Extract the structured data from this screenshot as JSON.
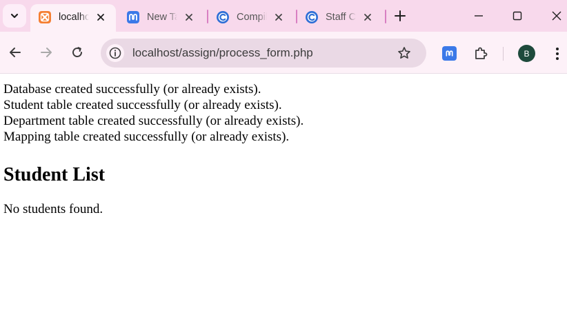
{
  "tabs": [
    {
      "title": "localhost/assign/process_form.php",
      "icon": "xampp-icon",
      "active": true
    },
    {
      "title": "New Tab",
      "icon": "app-icon",
      "active": false
    },
    {
      "title": "Compiler",
      "icon": "c-icon",
      "active": false
    },
    {
      "title": "Staff Compiler",
      "icon": "c-icon",
      "active": false
    }
  ],
  "toolbar": {
    "url": "localhost/assign/process_form.php",
    "profile_initial": "B"
  },
  "page": {
    "messages": [
      "Database created successfully (or already exists).",
      "Student table created successfully (or already exists).",
      "Department table created successfully (or already exists).",
      "Mapping table created successfully (or already exists)."
    ],
    "heading": "Student List",
    "empty_text": "No students found."
  },
  "colors": {
    "tabstrip": "#f8d9ec",
    "toolbar": "#fdf1f8",
    "omnibox": "#ead9e5",
    "xampp": "#f57f33",
    "app_blue": "#3b79e8",
    "avatar": "#1e4a3c"
  }
}
